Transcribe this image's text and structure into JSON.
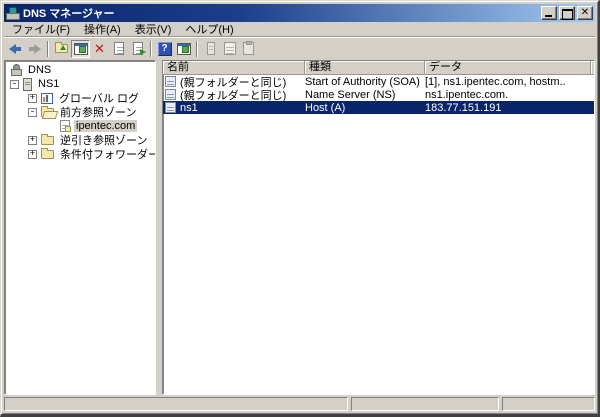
{
  "window": {
    "title": "DNS マネージャー"
  },
  "menubar": {
    "items": [
      {
        "label": "ファイル(F)"
      },
      {
        "label": "操作(A)"
      },
      {
        "label": "表示(V)"
      },
      {
        "label": "ヘルプ(H)"
      }
    ]
  },
  "icons": {
    "close_glyph": "✕",
    "delete_glyph": "✕",
    "help_glyph": "?"
  },
  "tree": {
    "items": [
      {
        "label": "DNS"
      },
      {
        "label": "NS1",
        "expander": "-"
      },
      {
        "label": "グローバル ログ",
        "expander": "+"
      },
      {
        "label": "前方参照ゾーン",
        "expander": "-"
      },
      {
        "label": "ipentec.com",
        "selected": true
      },
      {
        "label": "逆引き参照ゾーン",
        "expander": "+"
      },
      {
        "label": "条件付フォワーダー",
        "expander": "+"
      }
    ]
  },
  "list": {
    "columns": [
      "名前",
      "種類",
      "データ"
    ],
    "rows": [
      {
        "name": "(親フォルダーと同じ)",
        "type": "Start of Authority (SOA)",
        "data": "[1], ns1.ipentec.com, hostm.."
      },
      {
        "name": "(親フォルダーと同じ)",
        "type": "Name Server (NS)",
        "data": "ns1.ipentec.com."
      },
      {
        "name": "ns1",
        "type": "Host (A)",
        "data": "183.77.151.191",
        "selected": true
      }
    ]
  },
  "colors": {
    "titlebar_left": "#0a246a",
    "titlebar_right": "#a6caf0",
    "selection": "#0a246a",
    "chrome": "#d4d0c8"
  },
  "statusbar": {
    "panels": [
      "",
      "",
      ""
    ]
  }
}
